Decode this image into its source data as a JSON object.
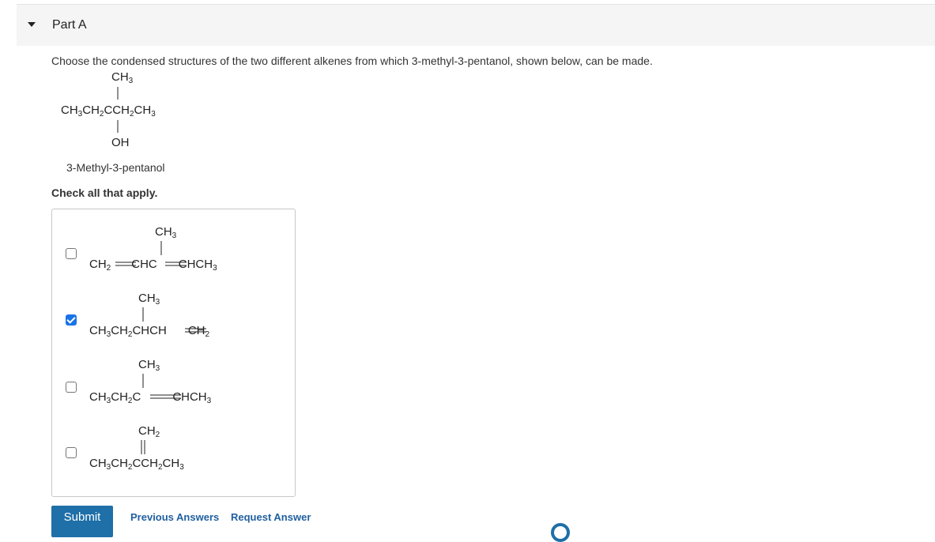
{
  "part": {
    "title": "Part A"
  },
  "question": {
    "text": "Choose the condensed structures of the two different alkenes from which 3-methyl-3-pentanol, shown below, can be made.",
    "compound_caption": "3-Methyl-3-pentanol",
    "instruction": "Check all that apply."
  },
  "options": [
    {
      "checked": false
    },
    {
      "checked": true
    },
    {
      "checked": false
    },
    {
      "checked": false
    }
  ],
  "actions": {
    "submit_label": "Submit",
    "previous_answers_label": "Previous Answers",
    "request_answer_label": "Request Answer"
  },
  "colors": {
    "accent": "#1f6fa8",
    "link": "#1f5f9f",
    "checkbox_checked": "#1a73e8"
  }
}
